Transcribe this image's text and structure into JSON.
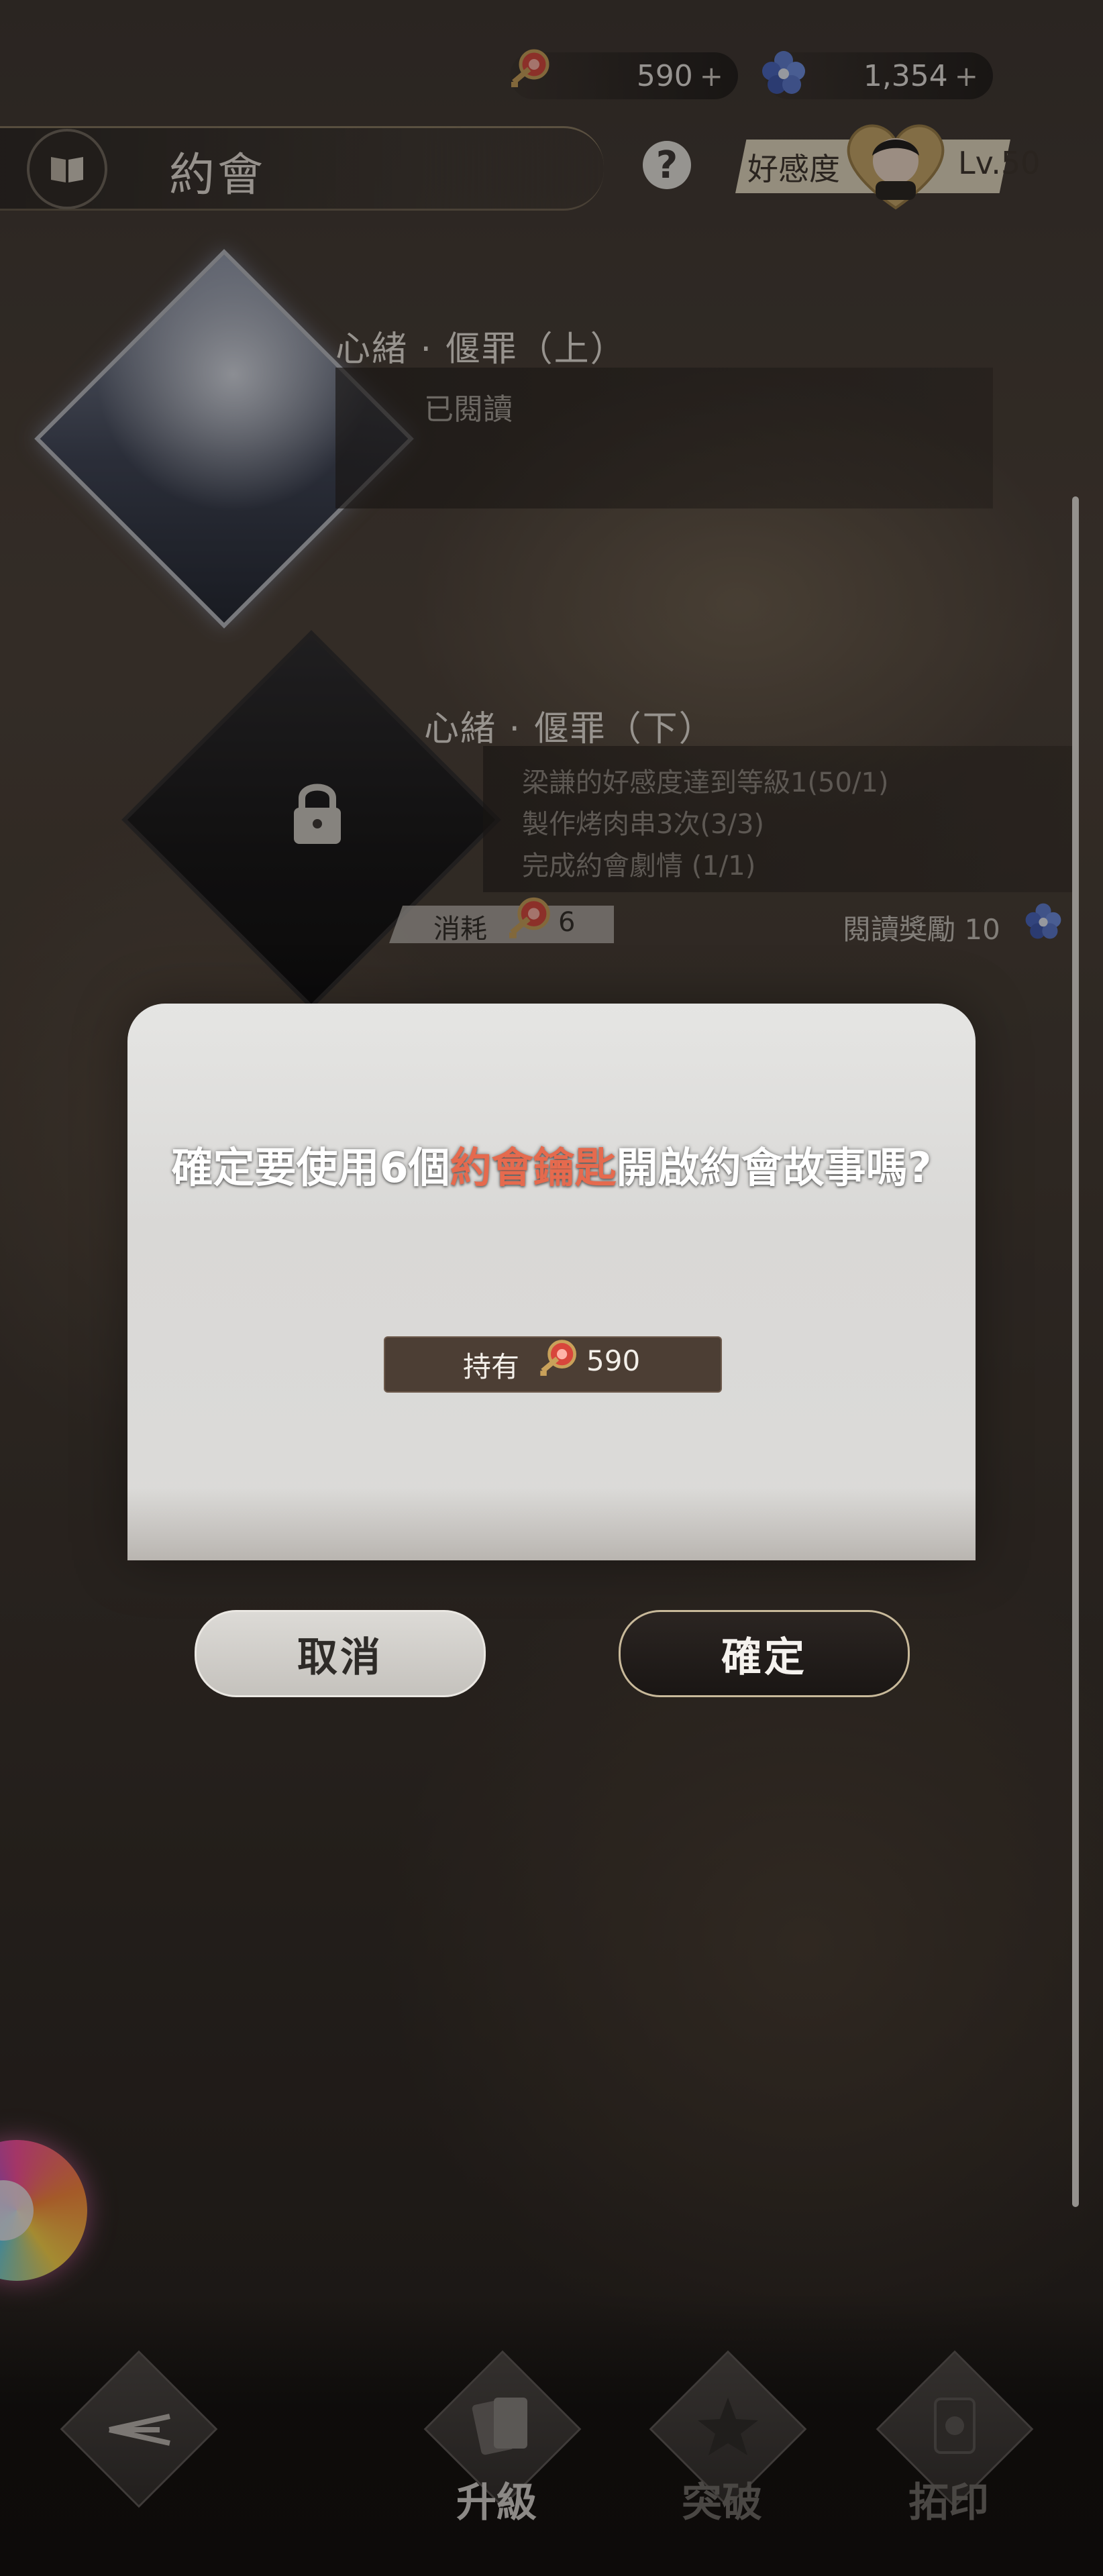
{
  "currency": {
    "key_count": "590",
    "gem_count": "1,354",
    "plus_symbol": "+"
  },
  "header": {
    "title": "約會",
    "help_symbol": "?",
    "affection_label": "好感度",
    "level": "Lv.50"
  },
  "stories": [
    {
      "title": "心緒 · 偃罪（上）",
      "status": "已閱讀"
    },
    {
      "title": "心緒 · 偃罪（下）",
      "requirements": [
        "梁謙的好感度達到等級1(50/1)",
        "製作烤肉串3次(3/3)",
        "完成約會劇情 (1/1)"
      ],
      "cost_label": "消耗",
      "cost_value": "6",
      "reward": "閱讀獎勵 10"
    }
  ],
  "dialog": {
    "message_before": "確定要使用6個",
    "message_highlight": "約會鑰匙",
    "message_after": "開啟約會故事嗎?",
    "owned_label": "持有",
    "owned_value": "590",
    "cancel_label": "取消",
    "confirm_label": "確定",
    "highlight_color": "#e56a4e"
  },
  "bottom_nav": {
    "upgrade": "升級",
    "breakthrough": "突破",
    "rubbing": "拓印"
  }
}
